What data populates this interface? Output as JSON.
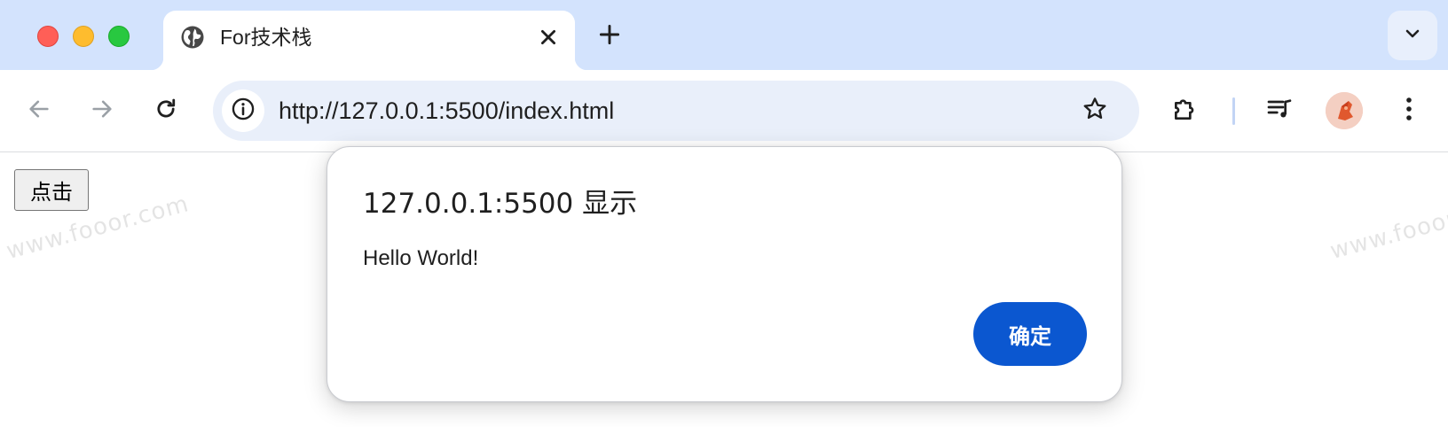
{
  "tab": {
    "title": "For技术栈",
    "close_icon": "close-icon",
    "favicon": "globe-icon"
  },
  "new_tab_icon": "plus-icon",
  "tab_search_icon": "chevron-down-icon",
  "toolbar": {
    "back_icon": "arrow-left-icon",
    "forward_icon": "arrow-right-icon",
    "reload_icon": "reload-icon",
    "site_info_icon": "info-icon",
    "url": "http://127.0.0.1:5500/index.html",
    "bookmark_icon": "star-icon",
    "extensions_icon": "puzzle-icon",
    "media_icon": "playlist-icon",
    "menu_icon": "kebab-menu-icon"
  },
  "page": {
    "button_label": "点击",
    "watermark": "www.fooor.com"
  },
  "dialog": {
    "title": "127.0.0.1:5500 显示",
    "message": "Hello World!",
    "ok_label": "确定"
  },
  "colors": {
    "tabstrip_bg": "#d3e3fd",
    "omnibox_bg": "#e9effa",
    "dialog_button": "#0b57d0",
    "traffic_red": "#ff5f57",
    "traffic_yellow": "#febc2e",
    "traffic_green": "#28c840"
  }
}
